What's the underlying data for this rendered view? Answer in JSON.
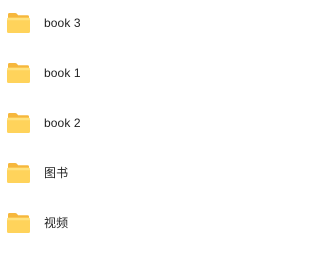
{
  "files": [
    {
      "name": "book 3",
      "icon": "folder-icon"
    },
    {
      "name": "book 1",
      "icon": "folder-icon"
    },
    {
      "name": "book 2",
      "icon": "folder-icon"
    },
    {
      "name": "图书",
      "icon": "folder-icon"
    },
    {
      "name": "视频",
      "icon": "folder-icon"
    }
  ],
  "colors": {
    "folder_back": "#F6B73C",
    "folder_front": "#FFD35B",
    "text": "#1F1F1F"
  }
}
